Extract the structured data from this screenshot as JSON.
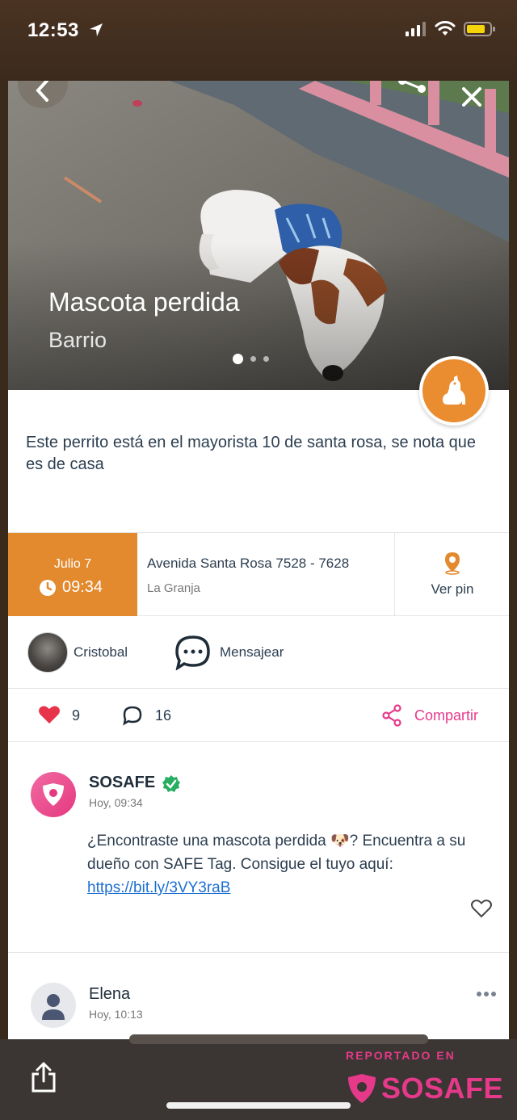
{
  "status_bar": {
    "time": "12:53"
  },
  "hero": {
    "title": "Mascota perdida",
    "subtitle": "Barrio",
    "carousel_count": 3,
    "carousel_active": 1
  },
  "report": {
    "description": "Este perrito está en el mayorista 10 de santa rosa, se nota que es de casa",
    "date": "Julio 7",
    "time": "09:34",
    "address": "Avenida Santa Rosa  7528 - 7628",
    "comuna": "La Granja",
    "pin_label": "Ver pin"
  },
  "user": {
    "name": "Cristobal",
    "message_label": "Mensajear"
  },
  "stats": {
    "likes": "9",
    "comments": "16",
    "share_label": "Compartir"
  },
  "comments": [
    {
      "author": "SOSAFE",
      "time": "Hoy, 09:34",
      "text": "¿Encontraste una mascota perdida 🐶? Encuentra a su dueño con SAFE Tag. Consigue el tuyo aquí:",
      "link": "https://bit.ly/3VY3raB"
    },
    {
      "author": "Elena",
      "time": "Hoy, 10:13"
    }
  ],
  "footer": {
    "reported_label": "REPORTADO EN",
    "brand": "SOSAFE"
  },
  "colors": {
    "accent_orange": "#e3892e",
    "accent_pink": "#e6398a",
    "text_dark": "#2c3e50"
  }
}
